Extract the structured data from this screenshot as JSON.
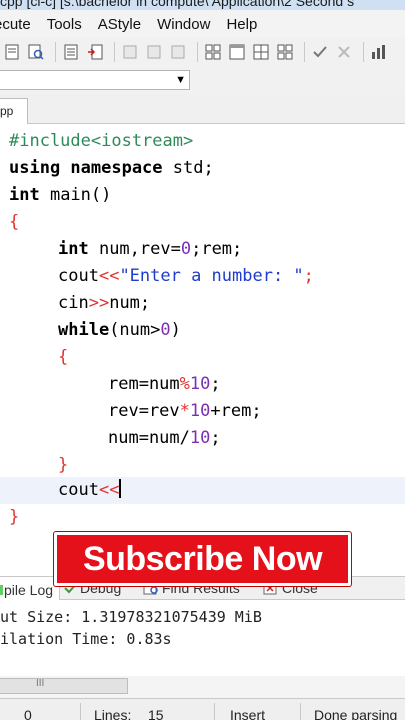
{
  "window": {
    "title": "cpp [ci-c] [s:\\bachelor in compute\\ Application\\2 Second s"
  },
  "menu": [
    "ecute",
    "Tools",
    "AStyle",
    "Window",
    "Help"
  ],
  "editor": {
    "tab_label": "pp",
    "code": {
      "l1": "#include<iostream>",
      "l2_kw": "using namespace",
      "l2_rest": " std;",
      "l3_kw": "int",
      "l3_rest": " main()",
      "l4": "{",
      "l5_kw": "int",
      "l5_a": " num,rev=",
      "l5_n": "0",
      "l5_b": ";rem;",
      "l6_a": "cout",
      "l6_op": "<<",
      "l6_str": "\"Enter a number: \"",
      "l6_end": ";",
      "l7_a": "cin",
      "l7_op": ">>",
      "l7_b": "num;",
      "l8_kw": "while",
      "l8_a": "(num>",
      "l8_n": "0",
      "l8_b": ")",
      "l9": "{",
      "l10_a": "rem=num",
      "l10_op": "%",
      "l10_n": "10",
      "l10_b": ";",
      "l11_a": "rev=rev",
      "l11_op": "*",
      "l11_n": "10",
      "l11_b": "+rem;",
      "l12_a": "num=num/",
      "l12_n": "10",
      "l12_b": ";",
      "l13": "}",
      "l14_a": "cout",
      "l14_op": "<<",
      "l15": "}"
    }
  },
  "overlay": {
    "subscribe_label": "Subscribe Now"
  },
  "bottom_tabs": {
    "compile_log": "pile Log",
    "debug": "Debug",
    "find_results": "Find Results",
    "close": "Close"
  },
  "log": {
    "line1": "ut Size: 1.31978321075439 MiB",
    "line2": "ilation Time: 0.83s"
  },
  "scrollbar": {
    "grip": "III"
  },
  "status": {
    "col_value": "0",
    "lines_label": "Lines:",
    "lines_value": "15",
    "mode": "Insert",
    "state": "Done parsing"
  },
  "colors": {
    "subscribe_bg": "#e4101a",
    "string": "#1f3ccc",
    "number": "#7a2fb5",
    "symbol": "#e0342f",
    "preprocessor": "#2e8b57"
  }
}
